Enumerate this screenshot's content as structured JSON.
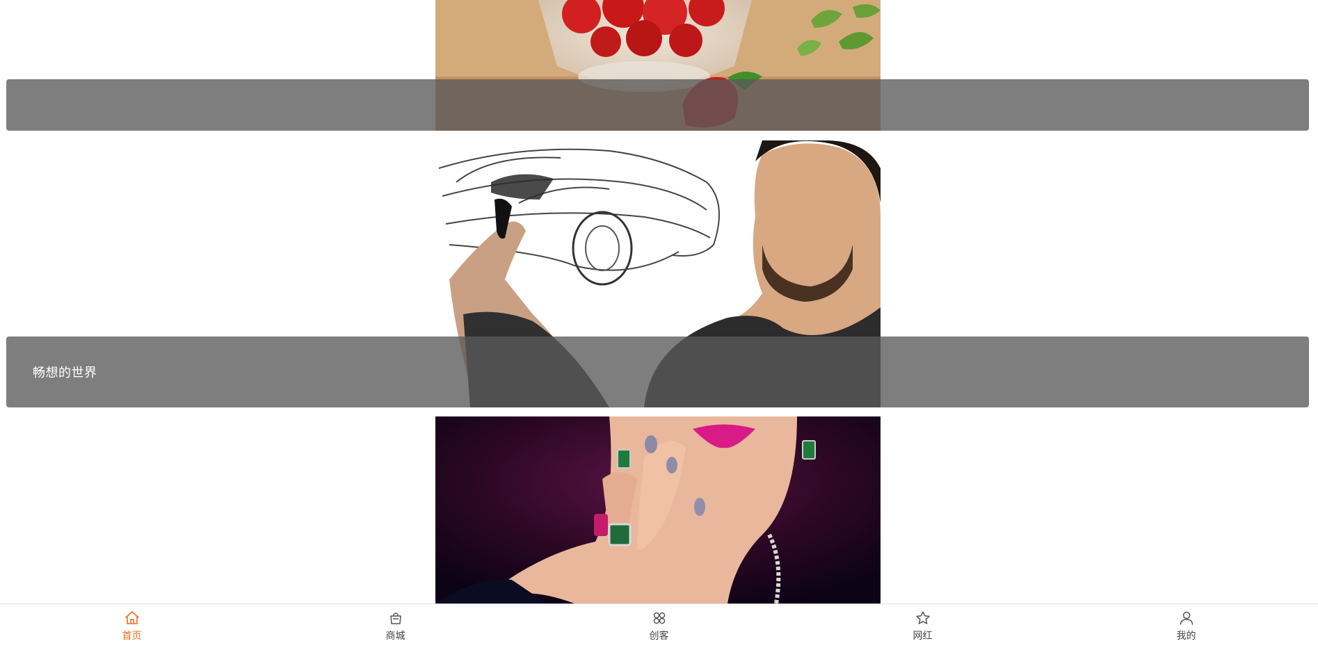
{
  "feed": {
    "cards": [
      {
        "title": "",
        "image": "strawberries-in-glass-bowl"
      },
      {
        "title": "畅想的世界",
        "image": "man-sketching-car"
      },
      {
        "title": "",
        "image": "woman-with-jewellery"
      }
    ]
  },
  "tabbar": {
    "active_color": "#f26b21",
    "items": [
      {
        "label": "首页",
        "icon": "home-icon",
        "active": true
      },
      {
        "label": "商城",
        "icon": "shopping-bag-icon",
        "active": false
      },
      {
        "label": "创客",
        "icon": "grid-icon",
        "active": false
      },
      {
        "label": "网红",
        "icon": "star-icon",
        "active": false
      },
      {
        "label": "我的",
        "icon": "user-icon",
        "active": false
      }
    ]
  }
}
